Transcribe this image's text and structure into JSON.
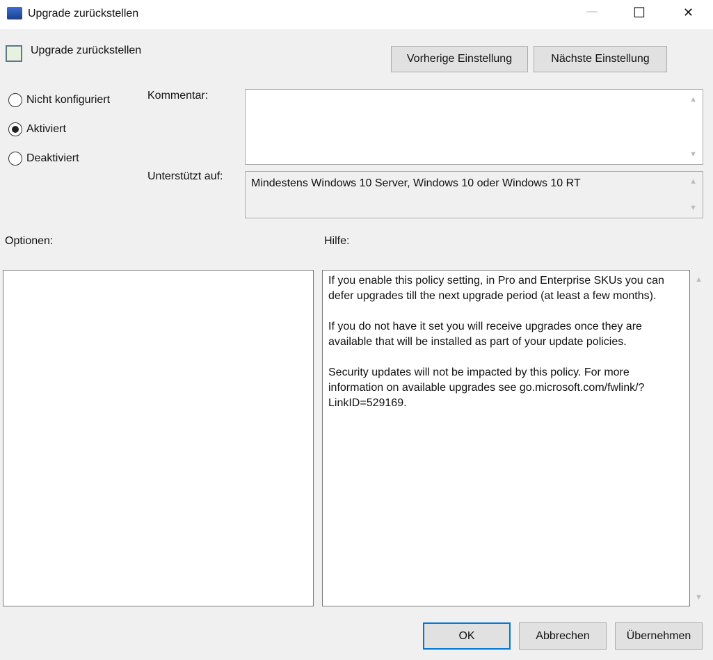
{
  "window": {
    "title": "Upgrade zurückstellen",
    "minimize": "—",
    "maximize": "☐",
    "close": "✕"
  },
  "header": {
    "title": "Upgrade zurückstellen",
    "prev_button": "Vorherige Einstellung",
    "next_button": "Nächste Einstellung"
  },
  "state": {
    "options": [
      "Nicht konfiguriert",
      "Aktiviert",
      "Deaktiviert"
    ],
    "selected": "Aktiviert"
  },
  "comment": {
    "label": "Kommentar:",
    "value": ""
  },
  "supported": {
    "label": "Unterstützt auf:",
    "value": "Mindestens Windows 10 Server, Windows 10 oder Windows 10 RT"
  },
  "options_label": "Optionen:",
  "help": {
    "label": "Hilfe:",
    "paragraphs": [
      "If you enable this policy setting, in Pro and Enterprise SKUs you can defer upgrades till the next upgrade period (at least a few months).",
      "If you do not have it set you will receive upgrades once they are available that will be installed as part of your update policies.",
      "Security updates will not be impacted by this policy. For more information on available upgrades see go.microsoft.com/fwlink/?LinkID=529169."
    ]
  },
  "footer": {
    "ok": "OK",
    "cancel": "Abbrechen",
    "apply": "Übernehmen"
  }
}
